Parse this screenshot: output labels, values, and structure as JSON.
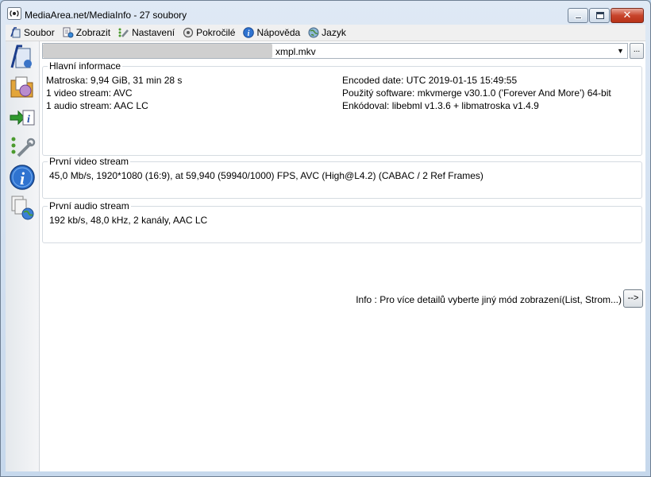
{
  "window": {
    "title": "MediaArea.net/MediaInfo - 27 soubory"
  },
  "menu": [
    {
      "label": "Soubor",
      "icon": "file-open-icon"
    },
    {
      "label": "Zobrazit",
      "icon": "view-icon"
    },
    {
      "label": "Nastavení",
      "icon": "settings-icon"
    },
    {
      "label": "Pokročilé",
      "icon": "advanced-icon"
    },
    {
      "label": "Nápověda",
      "icon": "help-icon"
    },
    {
      "label": "Jazyk",
      "icon": "language-icon"
    }
  ],
  "file_selector": {
    "value": "xmpl.mkv",
    "browse_label": "..."
  },
  "general": {
    "title": "Hlavní informace",
    "left": [
      "Matroska: 9,94 GiB, 31 min 28 s",
      "1 video stream: AVC",
      "1 audio stream: AAC LC"
    ],
    "right": [
      "Encoded date: UTC 2019-01-15 15:49:55",
      "Použitý software: mkvmerge v30.1.0 ('Forever And More') 64-bit",
      "Enkódoval: libebml v1.3.6 + libmatroska v1.4.9"
    ]
  },
  "video": {
    "title": "První video stream",
    "line": "45,0 Mb/s, 1920*1080 (16:9), at 59,940 (59940/1000) FPS, AVC (High@L4.2) (CABAC / 2 Ref Frames)"
  },
  "audio": {
    "title": "První audio stream",
    "line": "192 kb/s, 48,0 kHz, 2 kanály, AAC LC"
  },
  "footer": {
    "info": "Info : Pro více detailů vyberte jiný mód zobrazení(List, Strom...)",
    "button_label": "-->"
  }
}
